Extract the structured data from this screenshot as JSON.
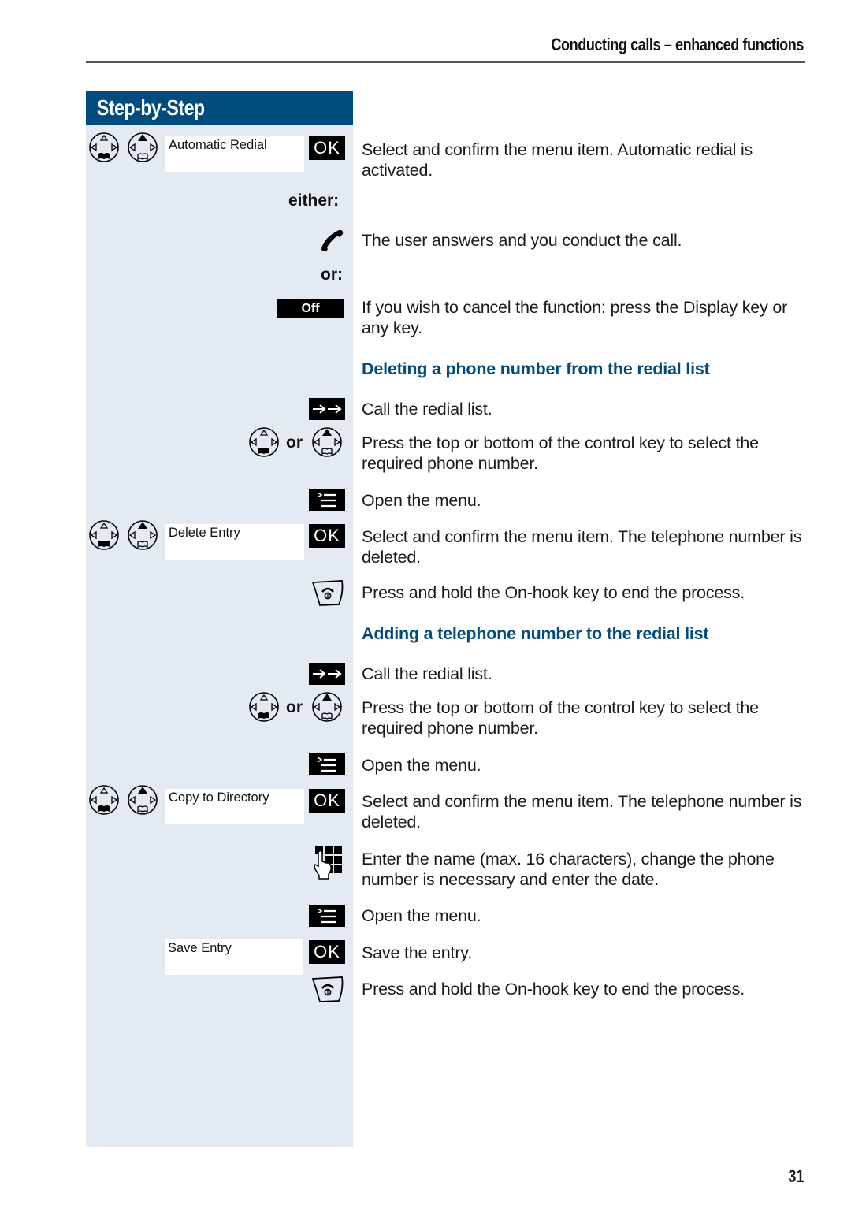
{
  "header": {
    "title": "Conducting calls – enhanced functions"
  },
  "sidebar": {
    "title": "Step-by-Step"
  },
  "labels": {
    "either": "either:",
    "or_colon": "or:",
    "or": "or"
  },
  "keys": {
    "ok": "OK",
    "off": "Off"
  },
  "menu_items": {
    "automatic_redial": "Automatic Redial",
    "delete_entry": "Delete Entry",
    "copy_to_directory": "Copy to Directory",
    "save_entry": "Save Entry"
  },
  "steps_intro": [
    {
      "text": "Select and confirm the menu item. Automatic redial is activated."
    },
    {
      "text": "The user answers and you conduct the call."
    },
    {
      "text": "If you wish to cancel the function: press the Display key or any key."
    }
  ],
  "sections": [
    {
      "heading": "Deleting a phone number from the redial list",
      "steps": [
        {
          "text": "Call the redial list."
        },
        {
          "text": "Press the top or bottom of the control key to select the required phone number."
        },
        {
          "text": "Open the menu."
        },
        {
          "text": "Select and confirm the menu item. The telephone number is deleted."
        },
        {
          "text": "Press and hold the On-hook key to end the process."
        }
      ]
    },
    {
      "heading": "Adding a telephone number to the redial list",
      "steps": [
        {
          "text": "Call the redial list."
        },
        {
          "text": "Press the top or bottom of the control key to select the required phone number."
        },
        {
          "text": "Open the menu."
        },
        {
          "text": "Select and confirm the menu item. The telephone number is deleted."
        },
        {
          "text": "Enter the name (max. 16 characters), change the phone number is necessary and enter the date."
        },
        {
          "text": "Open the menu."
        },
        {
          "text": "Save the entry."
        },
        {
          "text": "Press and hold the On-hook key to end the process."
        }
      ]
    }
  ],
  "footer": {
    "page_number": "31"
  },
  "colors": {
    "accent": "#004c7e",
    "sidebar_bg": "#e4eaf1"
  }
}
